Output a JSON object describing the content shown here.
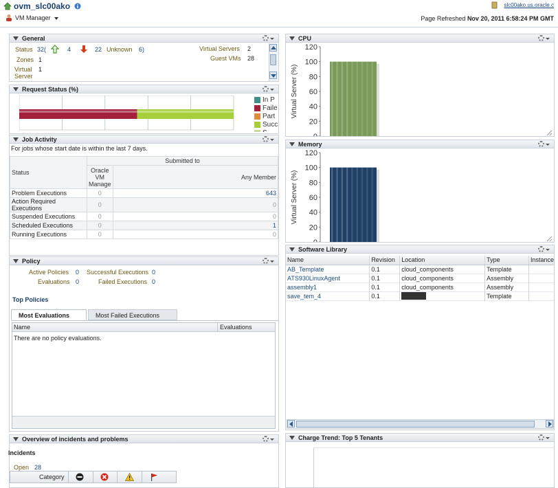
{
  "header": {
    "title": "ovm_slc00ako",
    "menu_label": "VM Manager",
    "host": "slc00ako.us.oracle.c",
    "refresh_label": "Page Refreshed",
    "refresh_time": "Nov 20, 2011 6:58:24 PM GMT"
  },
  "general": {
    "title": "General",
    "status_label": "Status",
    "status_total": "32(",
    "status_up": "4",
    "status_down": "22",
    "status_unknown_label": "Unknown",
    "status_unknown": "6)",
    "zones_label": "Zones",
    "zones_value": "1",
    "virtual_server_label": "Virtual Server",
    "virtual_server_value": "1",
    "virtual_servers_label": "Virtual Servers",
    "virtual_servers_value": "2",
    "guest_vms_label": "Guest VMs",
    "guest_vms_value": "28"
  },
  "request_status": {
    "title": "Request Status (%)",
    "failed_fraction": 0.55,
    "succeeded_fraction": 0.45,
    "legend": [
      "In P",
      "Faile",
      "Part",
      "Succ",
      "S..."
    ],
    "legend_colors": [
      "#3f8f8a",
      "#a3213d",
      "#e08a3c",
      "#a6cf3a",
      "#c9d99a"
    ]
  },
  "job_activity": {
    "title": "Job Activity",
    "subtitle": "For jobs whose start date is within the last 7 days.",
    "submitted_to": "Submitted to",
    "col_status": "Status",
    "col_oracle": "Oracle VM Manage",
    "col_any": "Any Member",
    "rows": [
      {
        "status": "Problem Executions",
        "oracle": "0",
        "any": "643"
      },
      {
        "status": "Action Required Executions",
        "oracle": "0",
        "any": "0"
      },
      {
        "status": "Suspended Executions",
        "oracle": "0",
        "any": "0"
      },
      {
        "status": "Scheduled Executions",
        "oracle": "0",
        "any": "1"
      },
      {
        "status": "Running Executions",
        "oracle": "0",
        "any": "0"
      }
    ]
  },
  "policy": {
    "title": "Policy",
    "active_label": "Active Policies",
    "active_value": "0",
    "successful_label": "Successful Executions",
    "successful_value": "0",
    "evaluations_label": "Evaluations",
    "evaluations_value": "0",
    "failed_label": "Failed Executions",
    "failed_value": "0",
    "top_policies": "Top Policies",
    "tab_most_evaluations": "Most Evaluations",
    "tab_most_failed": "Most Failed Executions",
    "col_name": "Name",
    "col_evaluations": "Evaluations",
    "empty_message": "There are no policy evaluations."
  },
  "incidents": {
    "title": "Overview of incidents and problems",
    "incidents_label": "Incidents",
    "open_label": "Open",
    "open_value": "28",
    "category_label": "Category"
  },
  "cpu": {
    "title": "CPU",
    "chart_data": {
      "type": "bar",
      "title": "",
      "ylabel": "Virtual Server (%)",
      "ylim": [
        0,
        120
      ],
      "yticks": [
        "120",
        "100",
        "80",
        "60",
        "40",
        "20",
        "0"
      ],
      "values": [
        100
      ],
      "color": "#7a9a5a"
    }
  },
  "memory": {
    "title": "Memory",
    "chart_data": {
      "type": "bar",
      "title": "",
      "ylabel": "Virtual Server (%)",
      "ylim": [
        0,
        120
      ],
      "yticks": [
        "120",
        "100",
        "80",
        "60",
        "40",
        "20",
        "0"
      ],
      "values": [
        100
      ],
      "color": "#1e3f66"
    }
  },
  "software_library": {
    "title": "Software Library",
    "columns": [
      "Name",
      "Revision",
      "Location",
      "Type",
      "Instance"
    ],
    "rows": [
      {
        "name": "AB_Template",
        "revision": "0.1",
        "location": "cloud_components",
        "type": "Template"
      },
      {
        "name": "ATS930LinuxAgent",
        "revision": "0.1",
        "location": "cloud_components",
        "type": "Assembly"
      },
      {
        "name": "assembly1",
        "revision": "0.1",
        "location": "cloud_components",
        "type": "Assembly"
      },
      {
        "name": "save_tem_4",
        "revision": "0.1",
        "location": "",
        "type": "Template"
      }
    ]
  },
  "charge_trend": {
    "title": "Charge Trend: Top 5 Tenants"
  },
  "colors": {
    "up_arrow": "#4a9a2a",
    "down_arrow": "#d43a1a",
    "link": "#1b4a7f"
  }
}
